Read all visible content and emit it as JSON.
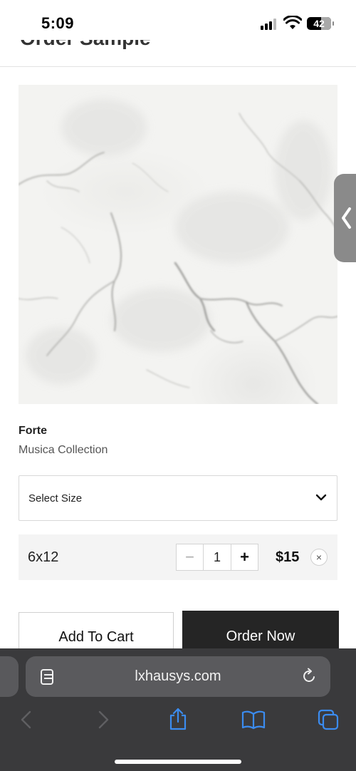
{
  "status_bar": {
    "time": "5:09",
    "battery": "42"
  },
  "header": {
    "title": "Order Sample"
  },
  "product": {
    "name": "Forte",
    "collection": "Musica Collection"
  },
  "size_select": {
    "label": "Select Size"
  },
  "cart_item": {
    "size": "6x12",
    "quantity": "1",
    "price": "$15",
    "minus_label": "−",
    "plus_label": "+",
    "remove_label": "×"
  },
  "actions": {
    "add_to_cart": "Add To Cart",
    "order_now": "Order Now"
  },
  "browser": {
    "url": "lxhausys.com"
  },
  "colors": {
    "order_button": "#252525",
    "safari_bar": "#3a3a3c",
    "toolbar_accent": "#3b8cf0"
  }
}
